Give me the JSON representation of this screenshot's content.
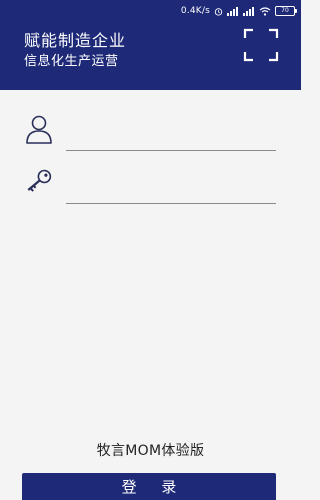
{
  "status_bar": {
    "network_speed": "0.4K/s",
    "battery_level": "70"
  },
  "header": {
    "title": "赋能制造企业",
    "subtitle": "信息化生产运营"
  },
  "login_form": {
    "username_value": "",
    "password_value": ""
  },
  "footer": {
    "version_text": "牧言MOM体验版",
    "login_label": "登 录"
  },
  "colors": {
    "brand": "#1e2a78",
    "background": "#f4f4f4",
    "underline": "#8a8a8a"
  },
  "icons": {
    "scan": "scan-frame-icon",
    "user": "user-icon",
    "key": "key-icon"
  }
}
